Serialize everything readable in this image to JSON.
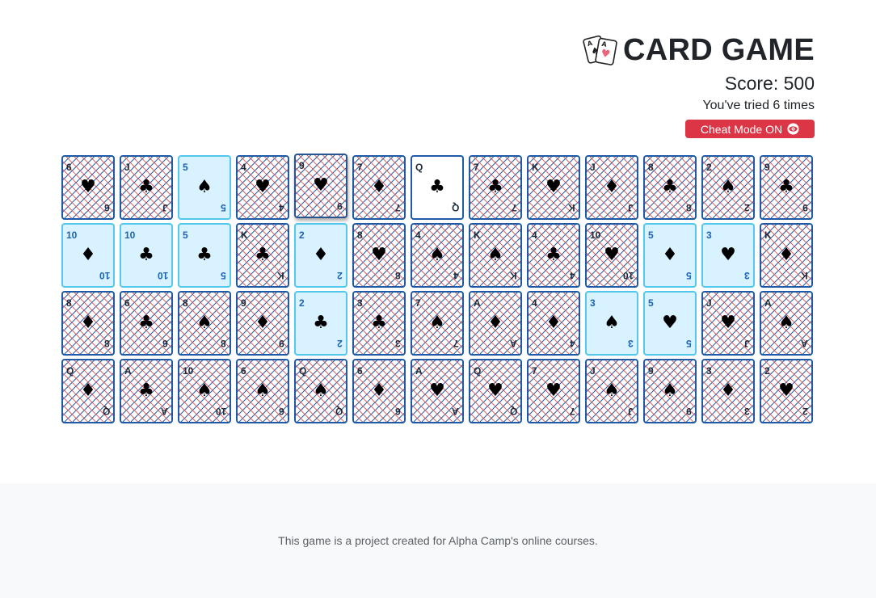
{
  "header": {
    "title": "CARD GAME",
    "score": "Score: 500",
    "tries": "You've tried 6 times",
    "cheat_label": "Cheat Mode ON",
    "cheat_icon": "eye-icon",
    "logo_icon": "playing-cards-icon"
  },
  "colors": {
    "cheat_button": "#dc3545",
    "card_border": "#1f5aa6",
    "open_card_bg": "#d8f2ff",
    "open_card_border": "#52c8ee"
  },
  "cards": [
    {
      "rank": "6",
      "suit": "♥",
      "state": "back"
    },
    {
      "rank": "J",
      "suit": "♣",
      "state": "back"
    },
    {
      "rank": "5",
      "suit": "♠",
      "state": "open"
    },
    {
      "rank": "4",
      "suit": "♥",
      "state": "back"
    },
    {
      "rank": "9",
      "suit": "♥",
      "state": "lifted"
    },
    {
      "rank": "7",
      "suit": "♦",
      "state": "back"
    },
    {
      "rank": "Q",
      "suit": "♣",
      "state": "flipped"
    },
    {
      "rank": "7",
      "suit": "♣",
      "state": "back"
    },
    {
      "rank": "K",
      "suit": "♥",
      "state": "back"
    },
    {
      "rank": "J",
      "suit": "♦",
      "state": "back"
    },
    {
      "rank": "8",
      "suit": "♣",
      "state": "back"
    },
    {
      "rank": "2",
      "suit": "♠",
      "state": "back"
    },
    {
      "rank": "9",
      "suit": "♣",
      "state": "back"
    },
    {
      "rank": "10",
      "suit": "♦",
      "state": "open"
    },
    {
      "rank": "10",
      "suit": "♣",
      "state": "open"
    },
    {
      "rank": "5",
      "suit": "♣",
      "state": "open"
    },
    {
      "rank": "K",
      "suit": "♣",
      "state": "back"
    },
    {
      "rank": "2",
      "suit": "♦",
      "state": "open"
    },
    {
      "rank": "8",
      "suit": "♥",
      "state": "back"
    },
    {
      "rank": "4",
      "suit": "♠",
      "state": "back"
    },
    {
      "rank": "K",
      "suit": "♠",
      "state": "back"
    },
    {
      "rank": "4",
      "suit": "♣",
      "state": "back"
    },
    {
      "rank": "10",
      "suit": "♥",
      "state": "back"
    },
    {
      "rank": "5",
      "suit": "♦",
      "state": "open"
    },
    {
      "rank": "3",
      "suit": "♥",
      "state": "open"
    },
    {
      "rank": "K",
      "suit": "♦",
      "state": "back"
    },
    {
      "rank": "8",
      "suit": "♦",
      "state": "back"
    },
    {
      "rank": "6",
      "suit": "♣",
      "state": "back"
    },
    {
      "rank": "8",
      "suit": "♠",
      "state": "back"
    },
    {
      "rank": "9",
      "suit": "♦",
      "state": "back"
    },
    {
      "rank": "2",
      "suit": "♣",
      "state": "open"
    },
    {
      "rank": "3",
      "suit": "♣",
      "state": "back"
    },
    {
      "rank": "7",
      "suit": "♠",
      "state": "back"
    },
    {
      "rank": "A",
      "suit": "♦",
      "state": "back"
    },
    {
      "rank": "4",
      "suit": "♦",
      "state": "back"
    },
    {
      "rank": "3",
      "suit": "♠",
      "state": "open"
    },
    {
      "rank": "5",
      "suit": "♥",
      "state": "open"
    },
    {
      "rank": "J",
      "suit": "♥",
      "state": "back"
    },
    {
      "rank": "A",
      "suit": "♠",
      "state": "back"
    },
    {
      "rank": "Q",
      "suit": "♦",
      "state": "back"
    },
    {
      "rank": "A",
      "suit": "♣",
      "state": "back"
    },
    {
      "rank": "10",
      "suit": "♠",
      "state": "back"
    },
    {
      "rank": "6",
      "suit": "♠",
      "state": "back"
    },
    {
      "rank": "Q",
      "suit": "♠",
      "state": "back"
    },
    {
      "rank": "6",
      "suit": "♦",
      "state": "back"
    },
    {
      "rank": "A",
      "suit": "♥",
      "state": "back"
    },
    {
      "rank": "Q",
      "suit": "♥",
      "state": "back"
    },
    {
      "rank": "7",
      "suit": "♥",
      "state": "back"
    },
    {
      "rank": "J",
      "suit": "♠",
      "state": "back"
    },
    {
      "rank": "9",
      "suit": "♠",
      "state": "back"
    },
    {
      "rank": "3",
      "suit": "♦",
      "state": "back"
    },
    {
      "rank": "2",
      "suit": "♥",
      "state": "back"
    }
  ],
  "footer": {
    "text": "This game is a project created for Alpha Camp's online courses."
  }
}
